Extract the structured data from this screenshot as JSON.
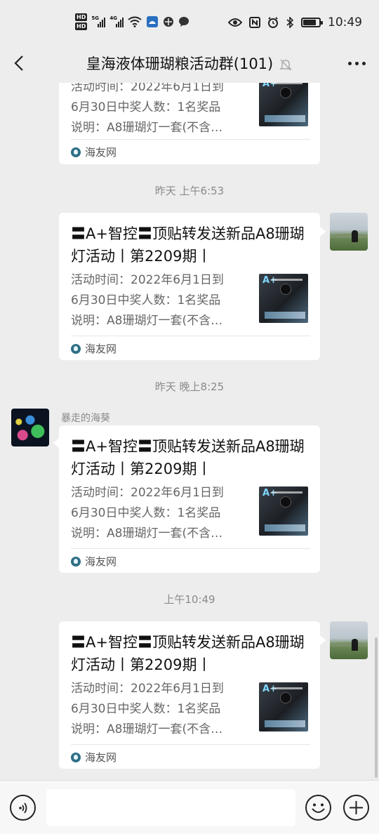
{
  "status_bar": {
    "hd1": "HD",
    "hd2": "HD",
    "net1": "5G",
    "net2": "4G",
    "time": "10:49",
    "battery_level": 0.8
  },
  "header": {
    "title": "皇海液体珊瑚粮活动群(101)"
  },
  "card_common": {
    "title": "〓A+智控〓顶贴转发送新品A8珊瑚灯活动丨第2209期丨",
    "desc_line1": "活动时间：2022年6月1日到",
    "desc_line2": "6月30日中奖人数：1名奖品",
    "desc_line3": "说明：A8珊瑚灯一套(不含…",
    "source": "海友网",
    "thumb_label": "A+"
  },
  "messages": [
    {
      "kind": "card",
      "side": "right",
      "partial": true
    },
    {
      "kind": "timestamp",
      "text": "昨天 上午6:53"
    },
    {
      "kind": "card",
      "side": "right"
    },
    {
      "kind": "timestamp",
      "text": "昨天 晚上8:25"
    },
    {
      "kind": "card",
      "side": "left",
      "sender": "暴走的海葵"
    },
    {
      "kind": "timestamp",
      "text": "上午10:49"
    },
    {
      "kind": "card",
      "side": "right"
    }
  ],
  "timestamps": [
    "昨天 上午6:53",
    "昨天 晚上8:25",
    "上午10:49"
  ],
  "sender_name": "暴走的海葵",
  "input": {
    "placeholder": "",
    "value": ""
  },
  "colors": {
    "background": "#ededed",
    "bubble": "#ffffff",
    "timestamp": "#8a8a8a",
    "source_logo": "#2e6f86"
  }
}
